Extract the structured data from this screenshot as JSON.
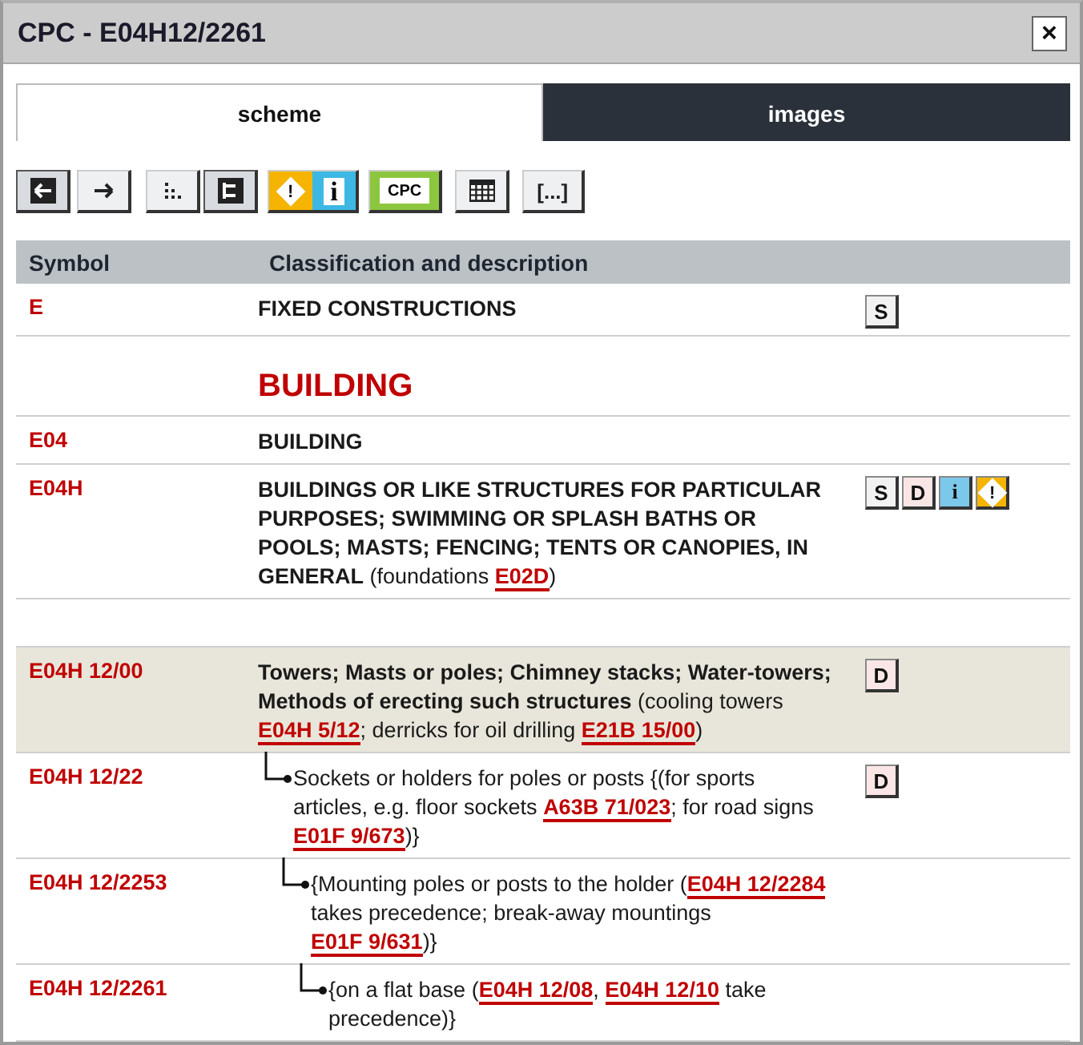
{
  "window": {
    "title": "CPC - E04H12/2261",
    "close": "×"
  },
  "tabs": [
    {
      "label": "scheme",
      "selected": true
    },
    {
      "label": "images",
      "selected": false
    }
  ],
  "toolbar": [
    {
      "kind": "back",
      "selected": true
    },
    {
      "kind": "forward",
      "selected": false
    },
    {
      "kind": "dots",
      "selected": false
    },
    {
      "kind": "tree",
      "selected": true
    },
    {
      "kind": "warn-info",
      "label": "!",
      "label2": "i",
      "selected": false
    },
    {
      "kind": "cpc",
      "label": "CPC",
      "selected": false
    },
    {
      "kind": "table",
      "selected": false
    },
    {
      "kind": "brackets",
      "label": "[...]",
      "selected": false
    }
  ],
  "table": {
    "columns": [
      "Symbol",
      "Classification and description"
    ],
    "rows": [
      {
        "kind": "entry",
        "symbol": "E",
        "text": [
          {
            "kind": "bold",
            "text": "FIXED CONSTRUCTIONS"
          }
        ],
        "badges": [
          {
            "kind": "s",
            "label": "S"
          }
        ]
      },
      {
        "kind": "heading",
        "text": "BUILDING"
      },
      {
        "kind": "entry",
        "symbol": "E04",
        "text": [
          {
            "kind": "bold",
            "text": "BUILDING"
          }
        ]
      },
      {
        "kind": "entry",
        "symbol": "E04H",
        "text": [
          {
            "kind": "bold",
            "text": "BUILDINGS OR LIKE STRUCTURES FOR PARTICULAR PURPOSES; SWIMMING OR SPLASH BATHS OR POOLS; MASTS; FENCING; TENTS OR CANOPIES, IN GENERAL"
          },
          {
            "kind": "plain",
            "text": " (foundations "
          },
          {
            "kind": "link",
            "text": "E02D"
          },
          {
            "kind": "plain",
            "text": ")"
          }
        ],
        "badges": [
          {
            "kind": "s",
            "label": "S"
          },
          {
            "kind": "d",
            "label": "D"
          },
          {
            "kind": "info",
            "label": "i"
          },
          {
            "kind": "warn",
            "label": "!"
          }
        ]
      },
      {
        "kind": "spacer"
      },
      {
        "kind": "entry",
        "symbol": "E04H 12/00",
        "highlighted": true,
        "text": [
          {
            "kind": "bold",
            "text": "Towers; Masts or poles; Chimney stacks; Water-towers; Methods of erecting such structures"
          },
          {
            "kind": "plain",
            "text": " (cooling towers "
          },
          {
            "kind": "link",
            "text": "E04H 5/12"
          },
          {
            "kind": "plain",
            "text": "; derricks for oil drilling "
          },
          {
            "kind": "link",
            "text": "E21B 15/00"
          },
          {
            "kind": "plain",
            "text": ")"
          }
        ],
        "badges": [
          {
            "kind": "d",
            "label": "D"
          }
        ],
        "children": [
          {
            "kind": "entry",
            "symbol": "E04H 12/22",
            "text": [
              {
                "kind": "plain",
                "text": "Sockets or holders for poles or posts {(for sports articles, e.g. floor sockets "
              },
              {
                "kind": "link",
                "text": "A63B 71/023"
              },
              {
                "kind": "plain",
                "text": "; for road signs "
              },
              {
                "kind": "link",
                "text": "E01F 9/673"
              },
              {
                "kind": "plain",
                "text": ")}"
              }
            ],
            "badges": [
              {
                "kind": "d",
                "label": "D"
              }
            ],
            "children": [
              {
                "kind": "entry",
                "symbol": "E04H 12/2253",
                "text": [
                  {
                    "kind": "plain",
                    "text": "{Mounting poles or posts to the holder ("
                  },
                  {
                    "kind": "link",
                    "text": "E04H 12/2284"
                  },
                  {
                    "kind": "plain",
                    "text": " takes precedence; break-away mountings "
                  },
                  {
                    "kind": "link",
                    "text": "E01F 9/631"
                  },
                  {
                    "kind": "plain",
                    "text": ")}"
                  }
                ],
                "children": [
                  {
                    "kind": "entry",
                    "symbol": "E04H 12/2261",
                    "text": [
                      {
                        "kind": "plain",
                        "text": "{on a flat base ("
                      },
                      {
                        "kind": "link",
                        "text": "E04H 12/08"
                      },
                      {
                        "kind": "plain",
                        "text": ", "
                      },
                      {
                        "kind": "link",
                        "text": "E04H 12/10"
                      },
                      {
                        "kind": "plain",
                        "text": " take precedence)}"
                      }
                    ]
                  }
                ]
              }
            ]
          }
        ]
      }
    ]
  }
}
